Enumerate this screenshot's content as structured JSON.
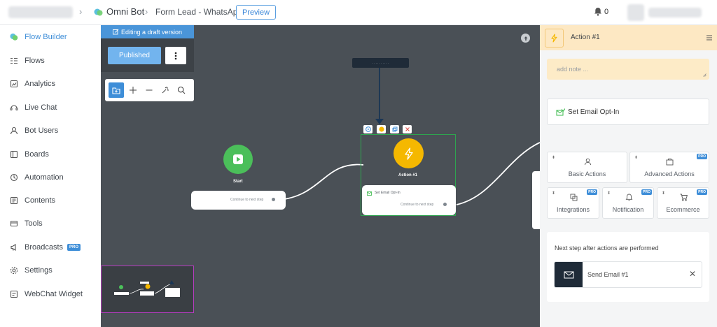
{
  "header": {
    "bot_name": "Omni Bot",
    "flow_name": "Form Lead - WhatsApp",
    "preview_label": "Preview",
    "notifications_count": "0"
  },
  "sidebar": {
    "items": [
      {
        "label": "Flow Builder",
        "icon": "flow-builder-icon",
        "active": true
      },
      {
        "label": "Flows",
        "icon": "flows-icon"
      },
      {
        "label": "Analytics",
        "icon": "analytics-icon"
      },
      {
        "label": "Live Chat",
        "icon": "live-chat-icon"
      },
      {
        "label": "Bot Users",
        "icon": "bot-users-icon"
      },
      {
        "label": "Boards",
        "icon": "boards-icon"
      },
      {
        "label": "Automation",
        "icon": "automation-icon"
      },
      {
        "label": "Contents",
        "icon": "contents-icon"
      },
      {
        "label": "Tools",
        "icon": "tools-icon"
      },
      {
        "label": "Broadcasts",
        "icon": "broadcasts-icon",
        "badge": "PRO"
      },
      {
        "label": "Settings",
        "icon": "settings-icon"
      },
      {
        "label": "WebChat Widget",
        "icon": "webchat-icon"
      }
    ]
  },
  "canvas": {
    "draft_banner": "Editing a draft version",
    "published_label": "Published",
    "start_node": {
      "title": "Start",
      "continue_label": "Continue to next step"
    },
    "action_node": {
      "title": "Action #1",
      "step_label": "Set Email Opt-In",
      "continue_label": "Continue to next step"
    },
    "tooltip_text": "· · · · · · · · · ·"
  },
  "right_panel": {
    "title": "Action #1",
    "note_placeholder": "add note ...",
    "optin_label": "Set Email Opt-In",
    "tiles": [
      {
        "label": "Basic Actions"
      },
      {
        "label": "Advanced Actions",
        "badge": "PRO"
      },
      {
        "label": "Integrations",
        "badge": "PRO"
      },
      {
        "label": "Notification",
        "badge": "PRO"
      },
      {
        "label": "Ecommerce",
        "badge": "PRO"
      }
    ],
    "next_step_title": "Next step after actions are performed",
    "next_step_item": "Send Email #1"
  },
  "colors": {
    "accent": "#3e8ed8",
    "canvas_bg": "#4a5056",
    "start_green": "#4bbf5a",
    "action_yellow": "#f5b800",
    "panel_header": "#fde8c3",
    "selection_green": "#2ea44f"
  }
}
